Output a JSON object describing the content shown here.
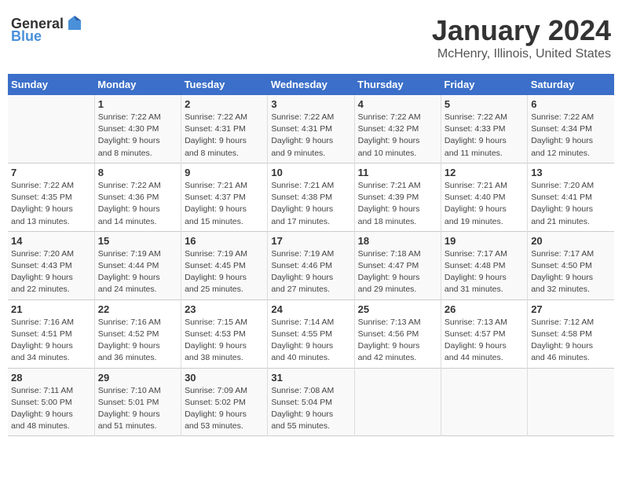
{
  "header": {
    "logo_general": "General",
    "logo_blue": "Blue",
    "title": "January 2024",
    "subtitle": "McHenry, Illinois, United States"
  },
  "columns": [
    "Sunday",
    "Monday",
    "Tuesday",
    "Wednesday",
    "Thursday",
    "Friday",
    "Saturday"
  ],
  "weeks": [
    [
      {
        "day": "",
        "info": ""
      },
      {
        "day": "1",
        "info": "Sunrise: 7:22 AM\nSunset: 4:30 PM\nDaylight: 9 hours\nand 8 minutes."
      },
      {
        "day": "2",
        "info": "Sunrise: 7:22 AM\nSunset: 4:31 PM\nDaylight: 9 hours\nand 8 minutes."
      },
      {
        "day": "3",
        "info": "Sunrise: 7:22 AM\nSunset: 4:31 PM\nDaylight: 9 hours\nand 9 minutes."
      },
      {
        "day": "4",
        "info": "Sunrise: 7:22 AM\nSunset: 4:32 PM\nDaylight: 9 hours\nand 10 minutes."
      },
      {
        "day": "5",
        "info": "Sunrise: 7:22 AM\nSunset: 4:33 PM\nDaylight: 9 hours\nand 11 minutes."
      },
      {
        "day": "6",
        "info": "Sunrise: 7:22 AM\nSunset: 4:34 PM\nDaylight: 9 hours\nand 12 minutes."
      }
    ],
    [
      {
        "day": "7",
        "info": "Sunrise: 7:22 AM\nSunset: 4:35 PM\nDaylight: 9 hours\nand 13 minutes."
      },
      {
        "day": "8",
        "info": "Sunrise: 7:22 AM\nSunset: 4:36 PM\nDaylight: 9 hours\nand 14 minutes."
      },
      {
        "day": "9",
        "info": "Sunrise: 7:21 AM\nSunset: 4:37 PM\nDaylight: 9 hours\nand 15 minutes."
      },
      {
        "day": "10",
        "info": "Sunrise: 7:21 AM\nSunset: 4:38 PM\nDaylight: 9 hours\nand 17 minutes."
      },
      {
        "day": "11",
        "info": "Sunrise: 7:21 AM\nSunset: 4:39 PM\nDaylight: 9 hours\nand 18 minutes."
      },
      {
        "day": "12",
        "info": "Sunrise: 7:21 AM\nSunset: 4:40 PM\nDaylight: 9 hours\nand 19 minutes."
      },
      {
        "day": "13",
        "info": "Sunrise: 7:20 AM\nSunset: 4:41 PM\nDaylight: 9 hours\nand 21 minutes."
      }
    ],
    [
      {
        "day": "14",
        "info": "Sunrise: 7:20 AM\nSunset: 4:43 PM\nDaylight: 9 hours\nand 22 minutes."
      },
      {
        "day": "15",
        "info": "Sunrise: 7:19 AM\nSunset: 4:44 PM\nDaylight: 9 hours\nand 24 minutes."
      },
      {
        "day": "16",
        "info": "Sunrise: 7:19 AM\nSunset: 4:45 PM\nDaylight: 9 hours\nand 25 minutes."
      },
      {
        "day": "17",
        "info": "Sunrise: 7:19 AM\nSunset: 4:46 PM\nDaylight: 9 hours\nand 27 minutes."
      },
      {
        "day": "18",
        "info": "Sunrise: 7:18 AM\nSunset: 4:47 PM\nDaylight: 9 hours\nand 29 minutes."
      },
      {
        "day": "19",
        "info": "Sunrise: 7:17 AM\nSunset: 4:48 PM\nDaylight: 9 hours\nand 31 minutes."
      },
      {
        "day": "20",
        "info": "Sunrise: 7:17 AM\nSunset: 4:50 PM\nDaylight: 9 hours\nand 32 minutes."
      }
    ],
    [
      {
        "day": "21",
        "info": "Sunrise: 7:16 AM\nSunset: 4:51 PM\nDaylight: 9 hours\nand 34 minutes."
      },
      {
        "day": "22",
        "info": "Sunrise: 7:16 AM\nSunset: 4:52 PM\nDaylight: 9 hours\nand 36 minutes."
      },
      {
        "day": "23",
        "info": "Sunrise: 7:15 AM\nSunset: 4:53 PM\nDaylight: 9 hours\nand 38 minutes."
      },
      {
        "day": "24",
        "info": "Sunrise: 7:14 AM\nSunset: 4:55 PM\nDaylight: 9 hours\nand 40 minutes."
      },
      {
        "day": "25",
        "info": "Sunrise: 7:13 AM\nSunset: 4:56 PM\nDaylight: 9 hours\nand 42 minutes."
      },
      {
        "day": "26",
        "info": "Sunrise: 7:13 AM\nSunset: 4:57 PM\nDaylight: 9 hours\nand 44 minutes."
      },
      {
        "day": "27",
        "info": "Sunrise: 7:12 AM\nSunset: 4:58 PM\nDaylight: 9 hours\nand 46 minutes."
      }
    ],
    [
      {
        "day": "28",
        "info": "Sunrise: 7:11 AM\nSunset: 5:00 PM\nDaylight: 9 hours\nand 48 minutes."
      },
      {
        "day": "29",
        "info": "Sunrise: 7:10 AM\nSunset: 5:01 PM\nDaylight: 9 hours\nand 51 minutes."
      },
      {
        "day": "30",
        "info": "Sunrise: 7:09 AM\nSunset: 5:02 PM\nDaylight: 9 hours\nand 53 minutes."
      },
      {
        "day": "31",
        "info": "Sunrise: 7:08 AM\nSunset: 5:04 PM\nDaylight: 9 hours\nand 55 minutes."
      },
      {
        "day": "",
        "info": ""
      },
      {
        "day": "",
        "info": ""
      },
      {
        "day": "",
        "info": ""
      }
    ]
  ]
}
